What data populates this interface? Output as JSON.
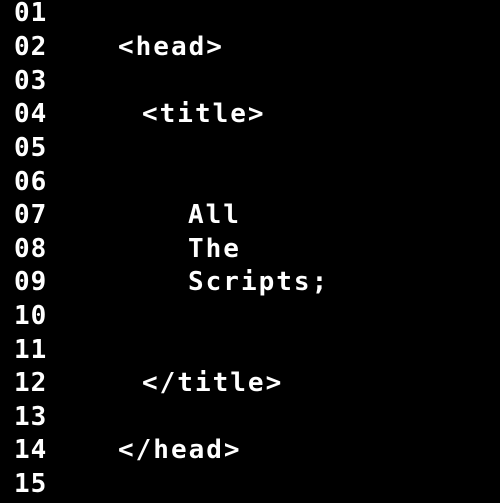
{
  "editor": {
    "lines": [
      {
        "number": "01",
        "text": ""
      },
      {
        "number": "02",
        "text": "<head>"
      },
      {
        "number": "03",
        "text": ""
      },
      {
        "number": "04",
        "text": "<title>"
      },
      {
        "number": "05",
        "text": ""
      },
      {
        "number": "06",
        "text": ""
      },
      {
        "number": "07",
        "text": "All"
      },
      {
        "number": "08",
        "text": "The"
      },
      {
        "number": "09",
        "text": "Scripts;"
      },
      {
        "number": "10",
        "text": ""
      },
      {
        "number": "11",
        "text": ""
      },
      {
        "number": "12",
        "text": "</title>"
      },
      {
        "number": "13",
        "text": ""
      },
      {
        "number": "14",
        "text": "</head>"
      },
      {
        "number": "15",
        "text": ""
      }
    ]
  },
  "colors": {
    "background": "#000000",
    "text": "#ffffff"
  }
}
